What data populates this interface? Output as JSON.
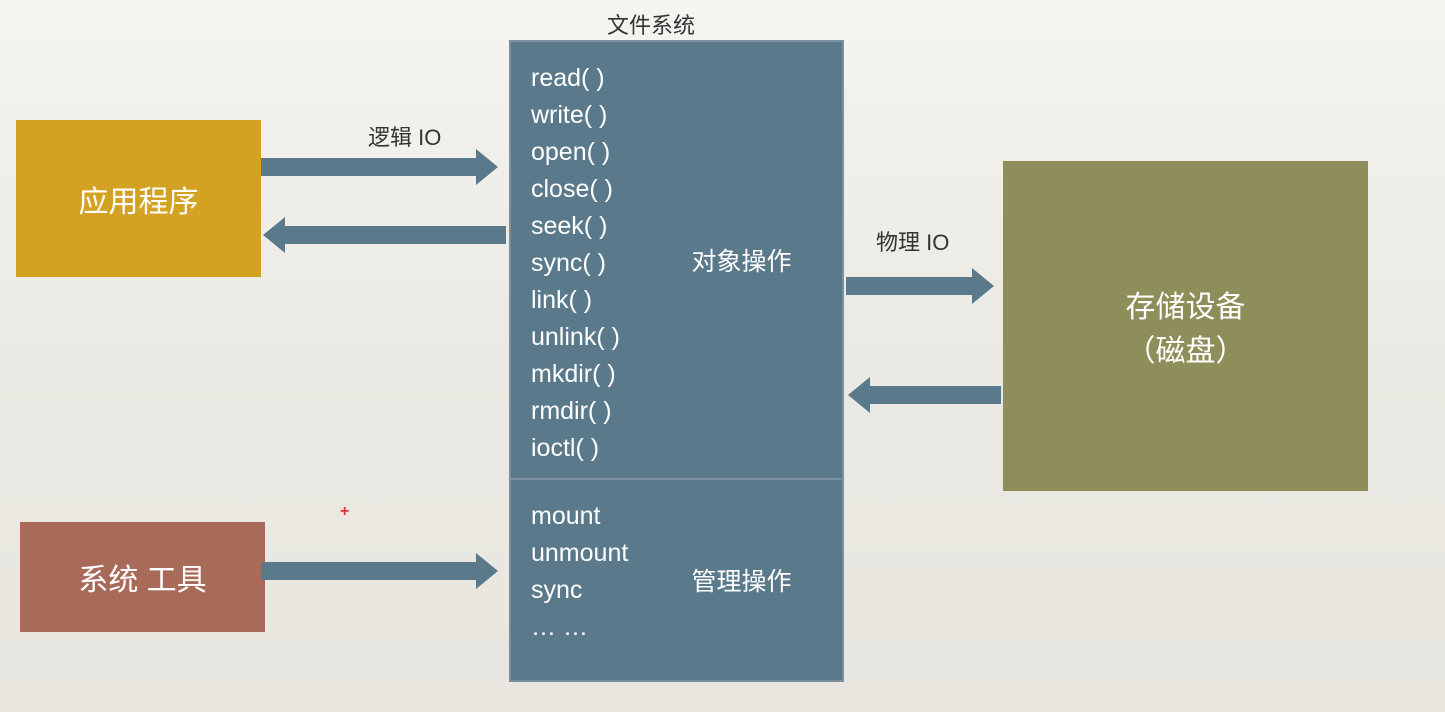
{
  "title": "文件系统",
  "boxes": {
    "application": "应用程序",
    "system_tools": "系统 工具",
    "storage_line1": "存储设备",
    "storage_line2": "（磁盘）"
  },
  "labels": {
    "logical_io": "逻辑 IO",
    "physical_io": "物理 IO",
    "plus": "+"
  },
  "filesystem": {
    "object_ops_title": "对象操作",
    "object_ops": [
      "read( )",
      "write( )",
      "open( )",
      "close( )",
      "seek( )",
      "sync( )",
      "link( )",
      "unlink( )",
      "mkdir( )",
      "rmdir( )",
      "ioctl( )"
    ],
    "mgmt_ops_title": "管理操作",
    "mgmt_ops": [
      "mount",
      "unmount",
      "sync",
      "… …"
    ]
  }
}
